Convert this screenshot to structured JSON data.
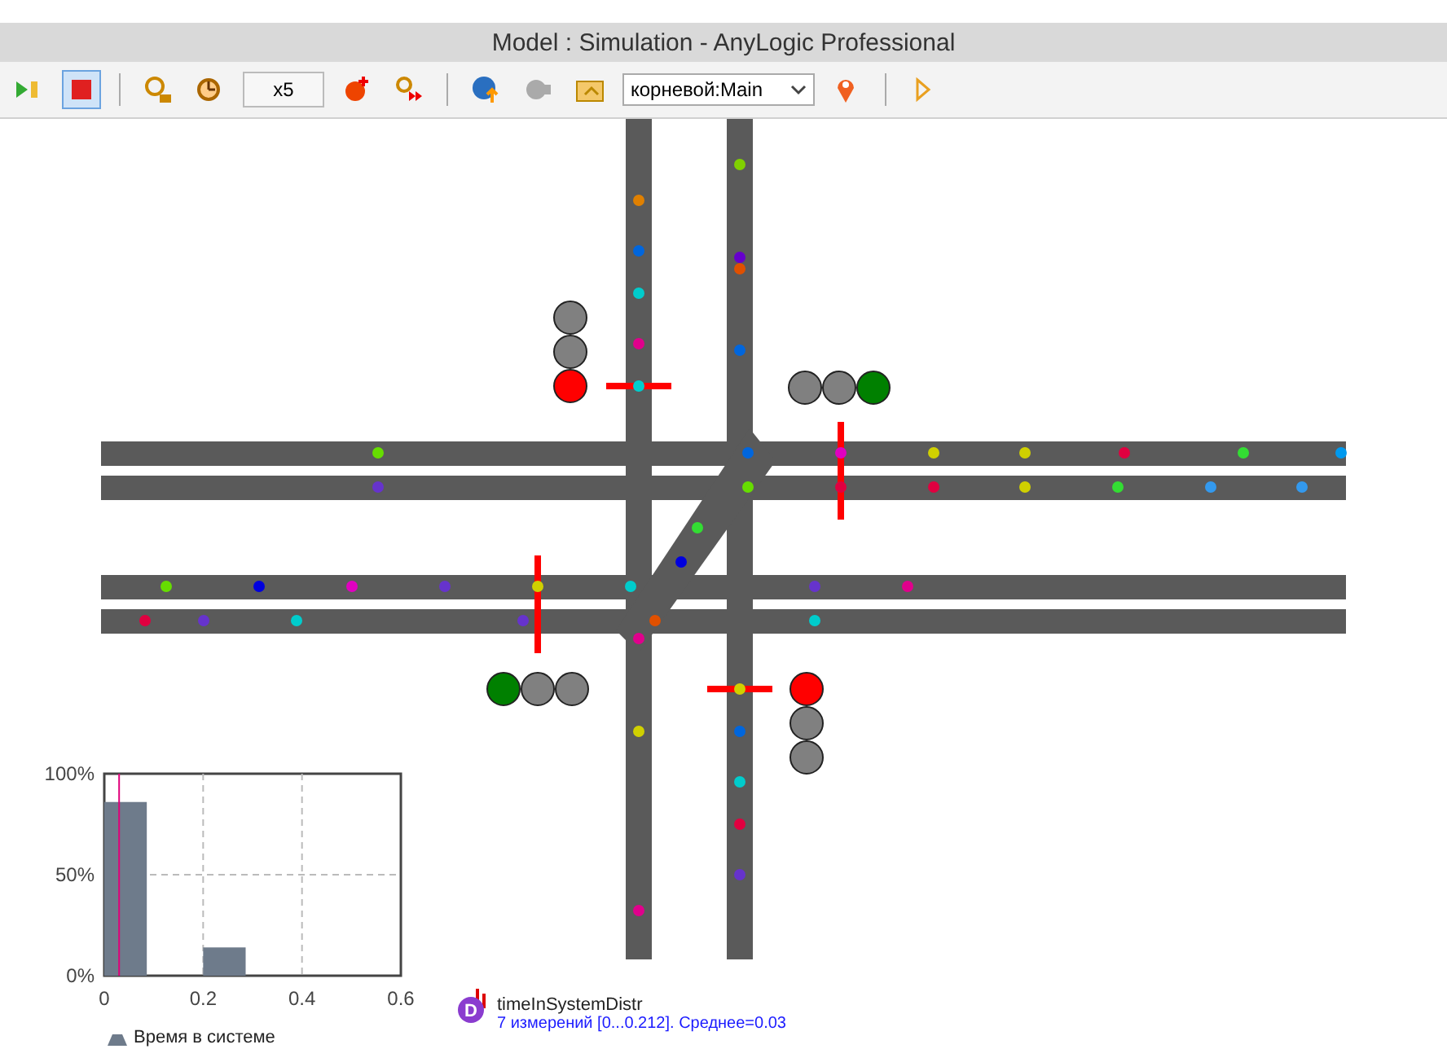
{
  "window": {
    "title": "Model : Simulation - AnyLogic Professional"
  },
  "toolbar": {
    "speed": "x5",
    "root_selector": "корневой:Main",
    "stop_selected": true
  },
  "traffic_lights": [
    {
      "lamps": [
        {
          "color": "#808080"
        },
        {
          "color": "#808080"
        },
        {
          "color": "#ff0000"
        }
      ]
    },
    {
      "lamps": [
        {
          "color": "#808080"
        },
        {
          "color": "#808080"
        },
        {
          "color": "#008000"
        }
      ]
    },
    {
      "lamps": [
        {
          "color": "#008000"
        },
        {
          "color": "#808080"
        },
        {
          "color": "#808080"
        }
      ]
    },
    {
      "lamps": [
        {
          "color": "#ff0000"
        },
        {
          "color": "#808080"
        },
        {
          "color": "#808080"
        }
      ]
    }
  ],
  "cars": [
    {
      "color": "#e08000"
    },
    {
      "color": "#0066dd"
    },
    {
      "color": "#00cccc"
    },
    {
      "color": "#e0008c"
    },
    {
      "color": "#00cccc"
    },
    {
      "color": "#e0008c"
    },
    {
      "color": "#d0d000"
    },
    {
      "color": "#e0008c"
    },
    {
      "color": "#80d000"
    },
    {
      "color": "#6600cc"
    },
    {
      "color": "#e05000"
    },
    {
      "color": "#0066dd"
    },
    {
      "color": "#d0d000"
    },
    {
      "color": "#0066dd"
    },
    {
      "color": "#00cccc"
    },
    {
      "color": "#e00040"
    },
    {
      "color": "#6633cc"
    },
    {
      "color": "#66dd00"
    },
    {
      "color": "#0066dd"
    },
    {
      "color": "#e000c0"
    },
    {
      "color": "#d0d000"
    },
    {
      "color": "#d0d000"
    },
    {
      "color": "#e00040"
    },
    {
      "color": "#33dd33"
    },
    {
      "color": "#0099ee"
    },
    {
      "color": "#6633cc"
    },
    {
      "color": "#66dd00"
    },
    {
      "color": "#e00040"
    },
    {
      "color": "#e00040"
    },
    {
      "color": "#d0d000"
    },
    {
      "color": "#33dd33"
    },
    {
      "color": "#3399ee"
    },
    {
      "color": "#3399ee"
    },
    {
      "color": "#66dd00"
    },
    {
      "color": "#0000dd"
    },
    {
      "color": "#e000c0"
    },
    {
      "color": "#6633cc"
    },
    {
      "color": "#d0d000"
    },
    {
      "color": "#00cccc"
    },
    {
      "color": "#6633cc"
    },
    {
      "color": "#e0008c"
    },
    {
      "color": "#e00040"
    },
    {
      "color": "#6633cc"
    },
    {
      "color": "#00cccc"
    },
    {
      "color": "#6633cc"
    },
    {
      "color": "#e05000"
    },
    {
      "color": "#00cccc"
    },
    {
      "color": "#33dd33"
    },
    {
      "color": "#0000dd"
    }
  ],
  "histogram": {
    "chart_data": {
      "type": "bar",
      "x": [
        0.043,
        0.243
      ],
      "series": [
        {
          "name": "Время в системе",
          "color": "#6e7b8b",
          "values": [
            0.86,
            0.14
          ]
        }
      ],
      "xlim": [
        0,
        0.6
      ],
      "ylim": [
        0,
        1
      ],
      "xticks": [
        0,
        0.2,
        0.4,
        0.6
      ],
      "yticks": [
        {
          "value": 0,
          "label": "0%"
        },
        {
          "value": 0.5,
          "label": "50%"
        },
        {
          "value": 1,
          "label": "100%"
        }
      ],
      "grid": true,
      "ref_lines": [
        {
          "axis": "x",
          "value": 0.03,
          "color": "#e0007a"
        }
      ]
    }
  },
  "statistics": {
    "name": "timeInSystemDistr",
    "summary": "7 измерений [0...0.212]. Среднее=0.03",
    "icon_letter": "D"
  }
}
